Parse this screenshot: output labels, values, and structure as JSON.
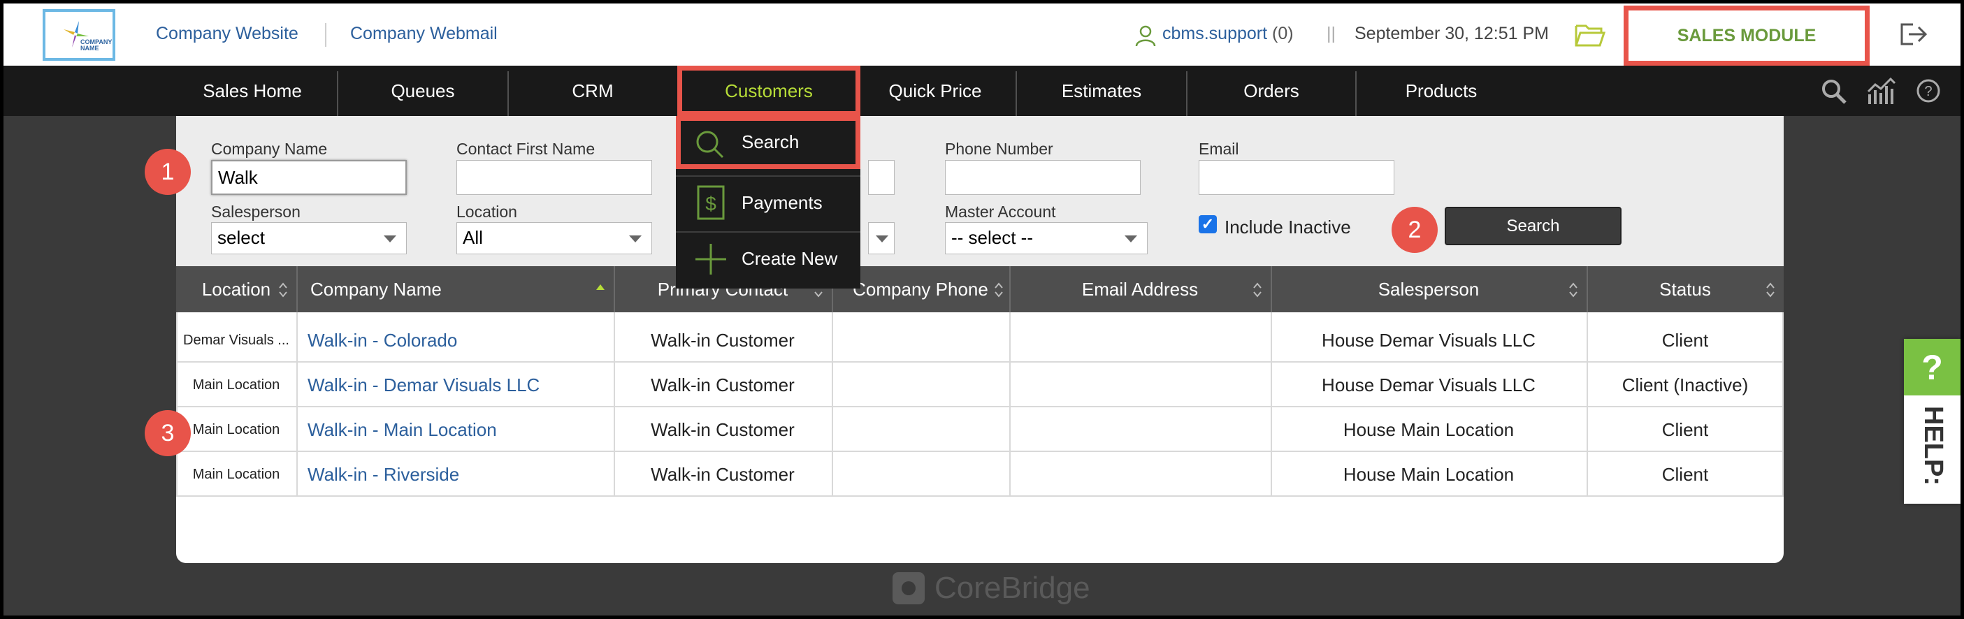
{
  "header": {
    "logo_text": "COMPANY NAME",
    "links": [
      "Company Website",
      "Company Webmail"
    ],
    "user": "cbms.support",
    "user_count": "(0)",
    "separator": "||",
    "datetime": "September 30, 12:51 PM",
    "module": "SALES MODULE"
  },
  "nav": {
    "items": [
      "Sales Home",
      "Queues",
      "CRM",
      "Customers",
      "Quick Price",
      "Estimates",
      "Orders",
      "Products"
    ],
    "active": "Customers"
  },
  "dropdown": {
    "items": [
      "Search",
      "Payments",
      "Create New"
    ]
  },
  "filters": {
    "company_name_label": "Company Name",
    "company_name_value": "Walk",
    "contact_first_name_label": "Contact First Name",
    "contact_first_name_value": "",
    "phone_label": "Phone Number",
    "phone_value": "",
    "email_label": "Email",
    "email_value": "",
    "salesperson_label": "Salesperson",
    "salesperson_value": "select",
    "location_label": "Location",
    "location_value": "All",
    "master_account_label": "Master Account",
    "master_account_value": "-- select --",
    "include_inactive_label": "Include Inactive",
    "include_inactive_checked": true,
    "search_button": "Search"
  },
  "badges": [
    "1",
    "2",
    "3"
  ],
  "table": {
    "headers": [
      "Location",
      "Company Name",
      "Primary Contact",
      "Company Phone",
      "Email Address",
      "Salesperson",
      "Status"
    ],
    "rows": [
      [
        "Demar Visuals ...",
        "Walk-in - Colorado",
        "Walk-in Customer",
        "",
        "",
        "House Demar Visuals LLC",
        "Client"
      ],
      [
        "Main Location",
        "Walk-in - Demar Visuals LLC",
        "Walk-in Customer",
        "",
        "",
        "House Demar Visuals LLC",
        "Client (Inactive)"
      ],
      [
        "Main Location",
        "Walk-in - Main Location",
        "Walk-in Customer",
        "",
        "",
        "House Main Location",
        "Client"
      ],
      [
        "Main Location",
        "Walk-in - Riverside",
        "Walk-in Customer",
        "",
        "",
        "House Main Location",
        "Client"
      ]
    ]
  },
  "help": {
    "q": "?",
    "label": "HELP:"
  },
  "watermark": "CoreBridge",
  "colors": {
    "accent": "#e8544a",
    "green": "#7ac143",
    "nav_bg": "#191919",
    "link": "#2c5f9c"
  }
}
